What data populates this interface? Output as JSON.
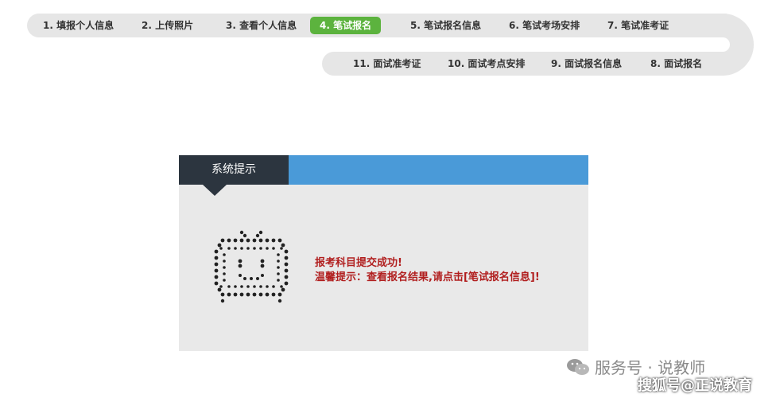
{
  "steps_row1": [
    {
      "label": "1. 填报个人信息",
      "active": false
    },
    {
      "label": "2. 上传照片",
      "active": false
    },
    {
      "label": "3. 查看个人信息",
      "active": false
    },
    {
      "label": "4. 笔试报名",
      "active": true
    },
    {
      "label": "5. 笔试报名信息",
      "active": false
    },
    {
      "label": "6. 笔试考场安排",
      "active": false
    },
    {
      "label": "7. 笔试准考证",
      "active": false
    }
  ],
  "steps_row2": [
    {
      "label": "11. 面试准考证"
    },
    {
      "label": "10. 面试考点安排"
    },
    {
      "label": "9. 面试报名信息"
    },
    {
      "label": "8. 面试报名"
    }
  ],
  "dialog": {
    "title": "系统提示",
    "message_line1": "报考科目提交成功!",
    "message_line2": "温馨提示：查看报名结果,请点击[笔试报名信息]!"
  },
  "watermarks": {
    "service_account": "服务号 · 说教师",
    "sohu": "搜狐号@正说教育"
  },
  "colors": {
    "active_step": "#5cb33e",
    "dialog_header": "#4a9ad8",
    "dialog_tab": "#2c353f",
    "message_text": "#b11e1e"
  }
}
